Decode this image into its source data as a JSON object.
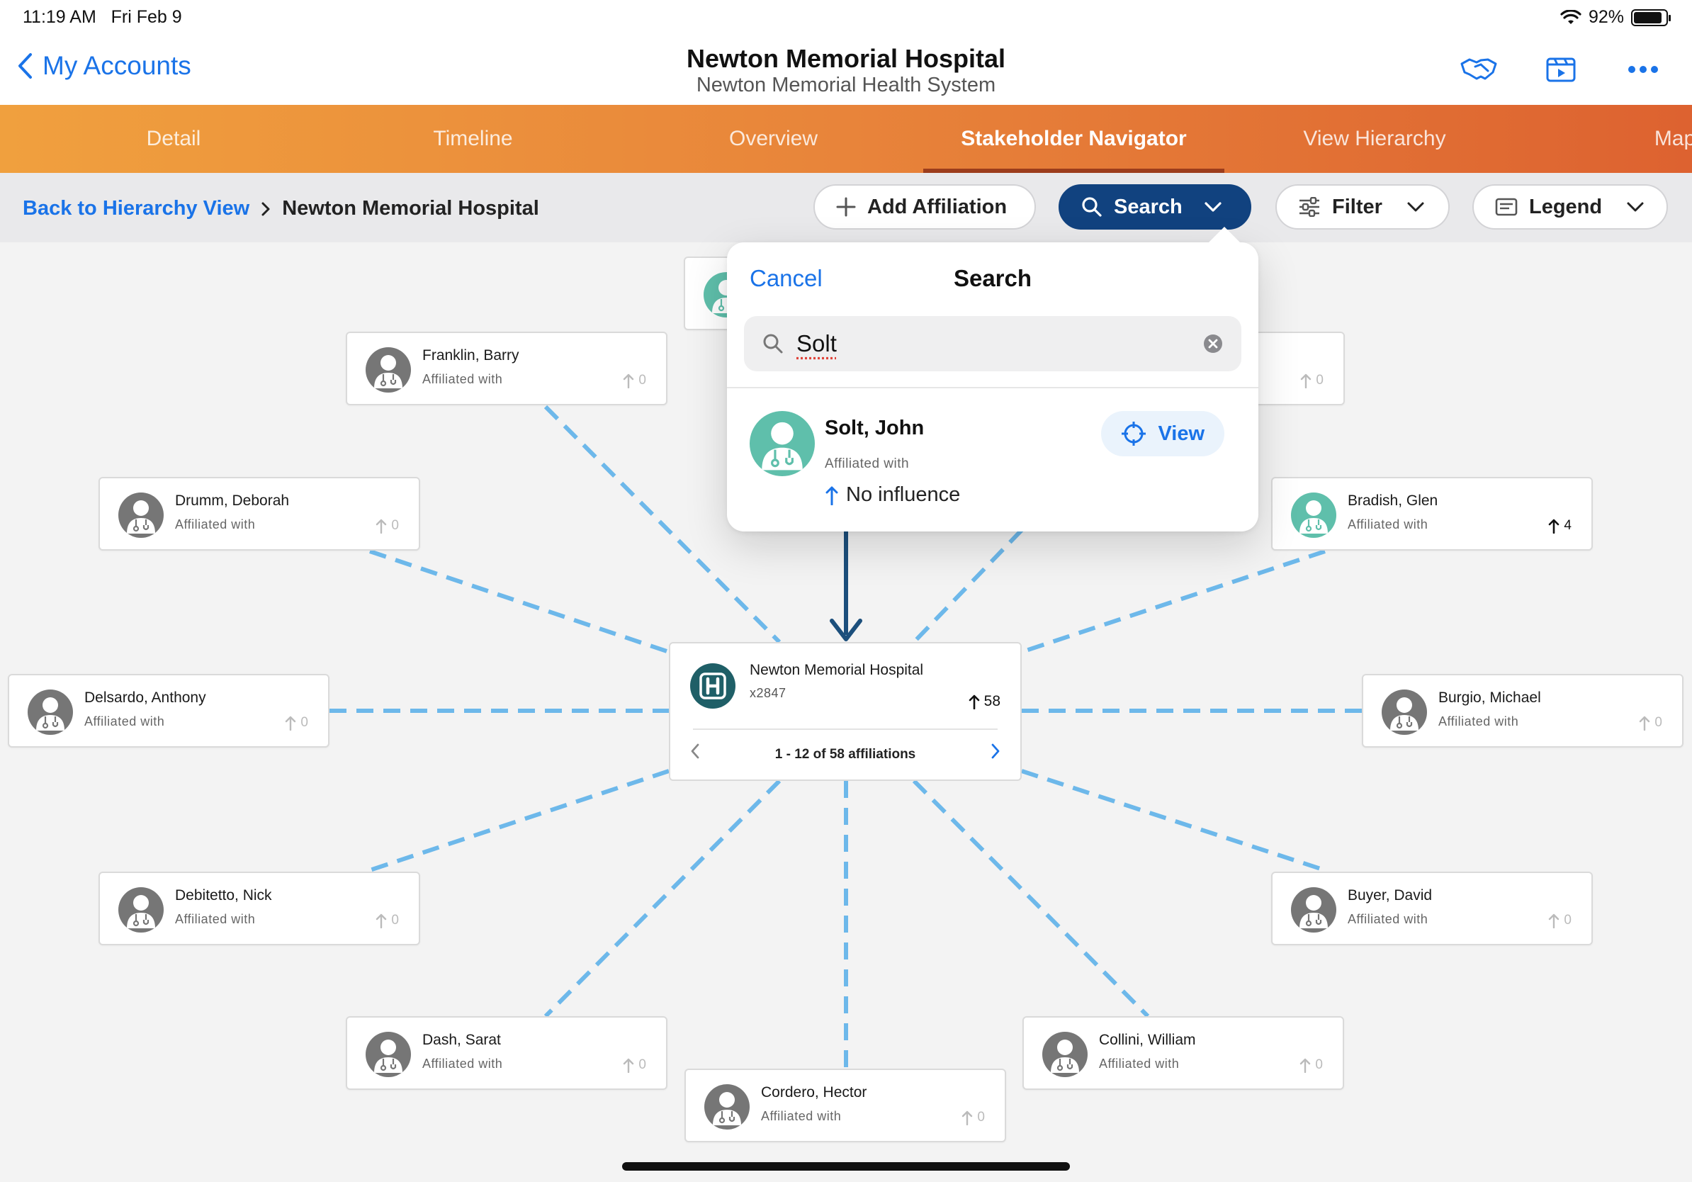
{
  "status": {
    "time": "11:19 AM",
    "date": "Fri Feb 9",
    "battery": "92%"
  },
  "nav": {
    "back_label": "My Accounts",
    "title": "Newton Memorial Hospital",
    "subtitle": "Newton Memorial Health System"
  },
  "tabs": [
    {
      "label": "Detail"
    },
    {
      "label": "Timeline"
    },
    {
      "label": "Overview"
    },
    {
      "label": "Stakeholder Navigator"
    },
    {
      "label": "View Hierarchy"
    },
    {
      "label": "Map"
    }
  ],
  "toolbar": {
    "breadcrumb_link": "Back to Hierarchy View",
    "breadcrumb_current": "Newton Memorial Hospital",
    "add_affiliation": "Add Affiliation",
    "search": "Search",
    "filter": "Filter",
    "legend": "Legend"
  },
  "hub": {
    "name": "Newton Memorial Hospital",
    "id": "x2847",
    "influence": "58",
    "pager": "1 - 12 of 58 affiliations"
  },
  "stakeholders": [
    {
      "name": "Franklin, Barry",
      "sub": "Affiliated with",
      "influence": "0"
    },
    {
      "name": "Drumm, Deborah",
      "sub": "Affiliated with",
      "influence": "0"
    },
    {
      "name": "Bradish, Glen",
      "sub": "Affiliated with",
      "influence": "4"
    },
    {
      "name": "Delsardo, Anthony",
      "sub": "Affiliated with",
      "influence": "0"
    },
    {
      "name": "Burgio, Michael",
      "sub": "Affiliated with",
      "influence": "0"
    },
    {
      "name": "Debitetto, Nick",
      "sub": "Affiliated with",
      "influence": "0"
    },
    {
      "name": "Buyer, David",
      "sub": "Affiliated with",
      "influence": "0"
    },
    {
      "name": "Dash, Sarat",
      "sub": "Affiliated with",
      "influence": "0"
    },
    {
      "name": "Collini, William",
      "sub": "Affiliated with",
      "influence": "0"
    },
    {
      "name": "Cordero, Hector",
      "sub": "Affiliated with",
      "influence": "0"
    },
    {
      "name": "",
      "sub": "",
      "influence": "0"
    }
  ],
  "popover": {
    "cancel": "Cancel",
    "title": "Search",
    "query": "Solt",
    "result": {
      "name": "Solt, John",
      "sub": "Affiliated with",
      "influence": "No influence",
      "view": "View"
    }
  },
  "colors": {
    "accent": "#1a73e8",
    "primary_button": "#11427f",
    "tab_gradient_start": "#f0a03e",
    "tab_gradient_end": "#dd6230",
    "connector": "#6db8ea",
    "teal_avatar": "#5fbfab",
    "gray_avatar": "#767676"
  }
}
